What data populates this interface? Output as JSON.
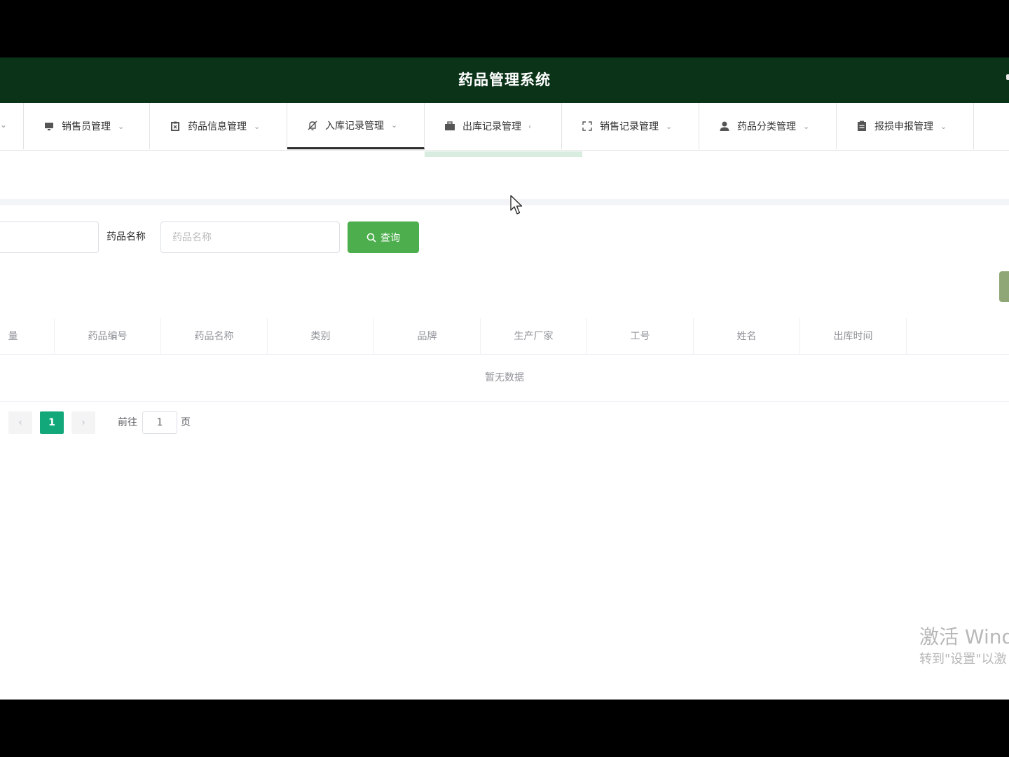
{
  "header": {
    "title": "药品管理系统"
  },
  "nav": {
    "items": [
      {
        "label": "销售员管理",
        "icon": "monitor-icon"
      },
      {
        "label": "药品信息管理",
        "icon": "clipboard-icon"
      },
      {
        "label": "入库记录管理",
        "icon": "bell-off-icon"
      },
      {
        "label": "出库记录管理",
        "icon": "briefcase-icon"
      },
      {
        "label": "销售记录管理",
        "icon": "fullscreen-icon"
      },
      {
        "label": "药品分类管理",
        "icon": "user-icon"
      },
      {
        "label": "报损申报管理",
        "icon": "document-icon"
      }
    ],
    "active_index": 2
  },
  "search": {
    "drug_name_label": "药品名称",
    "drug_name_placeholder": "药品名称",
    "query_label": "查询"
  },
  "table": {
    "columns": [
      "量",
      "药品编号",
      "药品名称",
      "类别",
      "品牌",
      "生产厂家",
      "工号",
      "姓名",
      "出库时间"
    ],
    "empty_text": "暂无数据"
  },
  "pagination": {
    "current_page": "1",
    "goto_label": "前往",
    "goto_value": "1",
    "page_suffix": "页"
  },
  "watermark": {
    "line1": "激活 Wind",
    "line2": "转到\"设置\"以激"
  },
  "colors": {
    "header_bg": "#0a3318",
    "primary_button": "#4cae4c",
    "active_page": "#13a87a"
  }
}
